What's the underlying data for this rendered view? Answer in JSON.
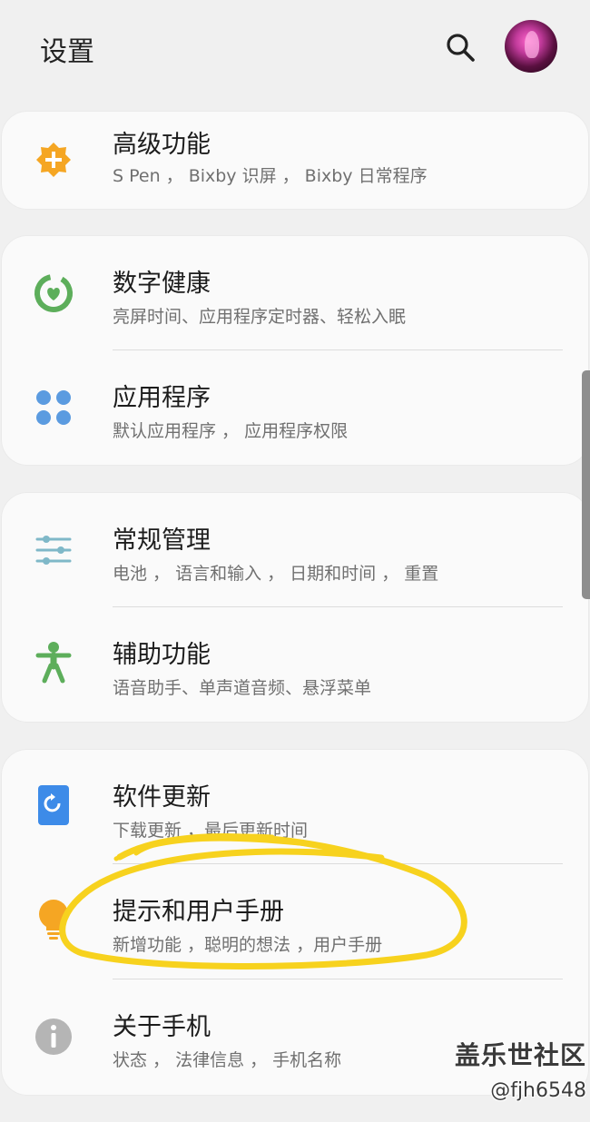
{
  "header": {
    "title": "设置",
    "search_icon": "search-icon",
    "avatar": "profile-avatar"
  },
  "groups": [
    {
      "items": [
        {
          "title": "高级功能",
          "subtitle": "S Pen ， Bixby 识屏 ， Bixby 日常程序",
          "icon": "puzzle-plus-icon",
          "icon_color": "#F5A623"
        }
      ]
    },
    {
      "items": [
        {
          "title": "数字健康",
          "subtitle": "亮屏时间、应用程序定时器、轻松入眠",
          "icon": "digital-wellbeing-icon",
          "icon_color": "#5DAE5B"
        },
        {
          "title": "应用程序",
          "subtitle": "默认应用程序 ， 应用程序权限",
          "icon": "apps-grid-icon",
          "icon_color": "#5B9BE0"
        }
      ]
    },
    {
      "items": [
        {
          "title": "常规管理",
          "subtitle": "电池 ， 语言和输入 ， 日期和时间 ， 重置",
          "icon": "sliders-icon",
          "icon_color": "#7FB8C8"
        },
        {
          "title": "辅助功能",
          "subtitle": "语音助手、单声道音频、悬浮菜单",
          "icon": "accessibility-icon",
          "icon_color": "#5DAE5B"
        }
      ]
    },
    {
      "items": [
        {
          "title": "软件更新",
          "subtitle": "下载更新 ，最后更新时间",
          "icon": "software-update-icon",
          "icon_color": "#3D8BE8"
        },
        {
          "title": "提示和用户手册",
          "subtitle": "新增功能 ，聪明的想法 ，用户手册",
          "icon": "lightbulb-icon",
          "icon_color": "#F5A623"
        },
        {
          "title": "关于手机",
          "subtitle": "状态 ， 法律信息 ， 手机名称",
          "icon": "info-icon",
          "icon_color": "#B5B5B5"
        }
      ]
    }
  ],
  "annotation": {
    "highlight_color": "#F7D21E"
  },
  "watermark": {
    "brand": "盖乐世社区",
    "user": "@fjh6548"
  }
}
